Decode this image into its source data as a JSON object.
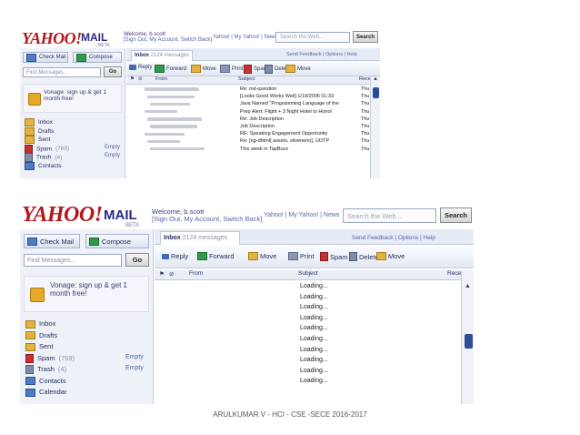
{
  "screens": [
    {
      "logo": "YAHOO!",
      "mail_word": "MAIL",
      "beta": "BETA",
      "welcome_line1": "Welcome, b.scott",
      "welcome_line2": "[Sign Out, My Account, Switch Back]",
      "top_nav_links": "Yahoo! | My Yahoo! | News",
      "search_placeholder": "Search the Web...",
      "search_button": "Search",
      "check_mail": "Check Mail",
      "compose": "Compose",
      "find_placeholder": "Find Messages...",
      "go_button": "Go",
      "promo_text": "Vonage: sign up & get 1 month free!",
      "folders": [
        {
          "name": "Inbox",
          "count": "",
          "action": ""
        },
        {
          "name": "Drafts",
          "count": "",
          "action": ""
        },
        {
          "name": "Sent",
          "count": "",
          "action": ""
        },
        {
          "name": "Spam",
          "count": "(769)",
          "action": "Empty"
        },
        {
          "name": "Trash",
          "count": "(4)",
          "action": "Empty"
        },
        {
          "name": "Contacts",
          "count": "",
          "action": ""
        }
      ],
      "tab_label": "Inbox",
      "tab_sub": "2124 messages",
      "right_links": "Send Feedback | Options | Help",
      "toolbar": [
        "Reply",
        "Forward",
        "Move",
        "Print",
        "Spam",
        "Delete",
        "Move"
      ],
      "columns": {
        "from": "From",
        "subject": "Subject",
        "date": "Received"
      },
      "messages": [
        {
          "subject": "Re: md-question",
          "date": "Thu,"
        },
        {
          "subject": "[Looks Good Works Well] 1/19/2006 01:33",
          "date": "Thu,"
        },
        {
          "subject": "Java Named \"Programming Language of the",
          "date": "Thu,"
        },
        {
          "subject": "Prep Alert: Flight + 3 Night Hotel to Honol",
          "date": "Thu,"
        },
        {
          "subject": "Re: Job Description",
          "date": "Thu,"
        },
        {
          "subject": "Job Description",
          "date": "Thu,"
        },
        {
          "subject": "RE: Speaking Engagement Opportunity",
          "date": "Thu,"
        },
        {
          "subject": "Re: [ng-dhtml] assets, silvenerio], UOTP",
          "date": "Thu,"
        },
        {
          "subject": "This week in TapBuzz",
          "date": "Thu,"
        }
      ]
    },
    {
      "logo": "YAHOO!",
      "mail_word": "MAIL",
      "beta": "BETA",
      "welcome_line1": "Welcome, b.scott",
      "welcome_line2": "[Sign Out, My Account, Switch Back]",
      "top_nav_links": "Yahoo! | My Yahoo! | News",
      "search_placeholder": "Search the Web...",
      "search_button": "Search",
      "check_mail": "Check Mail",
      "compose": "Compose",
      "find_placeholder": "Find Messages...",
      "go_button": "Go",
      "promo_text": "Vonage: sign up & get 1 month free!",
      "folders": [
        {
          "name": "Inbox",
          "count": "",
          "action": ""
        },
        {
          "name": "Drafts",
          "count": "",
          "action": ""
        },
        {
          "name": "Sent",
          "count": "",
          "action": ""
        },
        {
          "name": "Spam",
          "count": "(769)",
          "action": "Empty"
        },
        {
          "name": "Trash",
          "count": "(4)",
          "action": "Empty"
        },
        {
          "name": "Contacts",
          "count": "",
          "action": ""
        },
        {
          "name": "Calendar",
          "count": "",
          "action": ""
        }
      ],
      "tab_label": "Inbox",
      "tab_sub": "2124 messages",
      "right_links": "Send Feedback | Options | Help",
      "toolbar": [
        "Reply",
        "Forward",
        "Move",
        "Print",
        "Spam",
        "Delete",
        "Move"
      ],
      "columns": {
        "from": "From",
        "subject": "Subject",
        "date": "Received"
      },
      "messages": [
        {
          "subject": "Loading...",
          "date": ""
        },
        {
          "subject": "Loading...",
          "date": ""
        },
        {
          "subject": "Loading...",
          "date": ""
        },
        {
          "subject": "Loading...",
          "date": ""
        },
        {
          "subject": "Loading...",
          "date": ""
        },
        {
          "subject": "Loading...",
          "date": ""
        },
        {
          "subject": "Loading...",
          "date": ""
        },
        {
          "subject": "Loading...",
          "date": ""
        },
        {
          "subject": "Loading...",
          "date": ""
        },
        {
          "subject": "Loading...",
          "date": ""
        }
      ]
    }
  ],
  "footer": "ARULKUMAR V - HCI - CSE -SECE 2016-2017"
}
